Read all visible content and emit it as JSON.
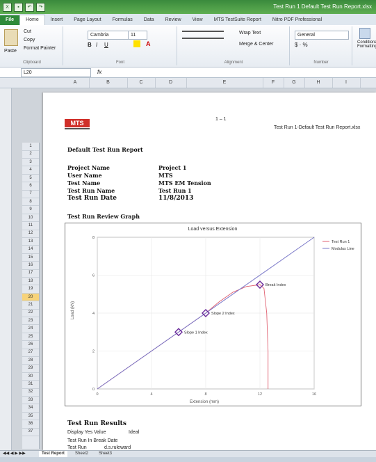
{
  "app": {
    "window_title": "Test Run 1 Default Test Run Report.xlsx"
  },
  "ribbon_tabs": [
    "File",
    "Home",
    "Insert",
    "Page Layout",
    "Formulas",
    "Data",
    "Review",
    "View",
    "MTS TestSuite Report",
    "Nitro PDF Professional"
  ],
  "ribbon": {
    "clipboard": {
      "paste": "Paste",
      "cut": "Cut",
      "copy": "Copy",
      "format_painter": "Format Painter",
      "group": "Clipboard"
    },
    "font": {
      "name": "Cambria",
      "size": "11",
      "group": "Font"
    },
    "alignment": {
      "wrap": "Wrap Text",
      "merge": "Merge & Center",
      "group": "Alignment"
    },
    "number": {
      "format": "General",
      "group": "Number"
    },
    "styles": {
      "conditional": "Conditional Formatting"
    }
  },
  "formula_bar": {
    "name_box": "L20",
    "fx": "fx"
  },
  "columns": [
    "A",
    "B",
    "C",
    "D",
    "E",
    "F",
    "G",
    "H",
    "I"
  ],
  "page": {
    "page_num": "1 – 1",
    "file_ref": "Test Run 1-Default Test Run Report.xlsx",
    "logo": "MTS",
    "report_title": "Default Test Run Report",
    "info": [
      {
        "label": "Project Name",
        "value": "Project 1"
      },
      {
        "label": "User Name",
        "value": "MTS"
      },
      {
        "label": "Test Name",
        "value": "MTS EM Tension"
      },
      {
        "label": "Test Run Name",
        "value": "Test Run 1"
      },
      {
        "label": "Test Run Date",
        "value": "11/8/2013"
      }
    ],
    "graph_heading": "Test Run Review Graph",
    "results_heading": "Test Run Results",
    "results_rows": [
      {
        "label": "Display Yes Value",
        "value": "Ideal"
      },
      {
        "label": "Test Run In Break Date",
        "value": ""
      },
      {
        "label": "Test Run",
        "value": "d.s.ruleward"
      }
    ]
  },
  "row_numbers": [
    "1",
    "2",
    "3",
    "4",
    "5",
    "6",
    "7",
    "8",
    "9",
    "10",
    "11",
    "12",
    "13",
    "14",
    "15",
    "16",
    "17",
    "18",
    "19",
    "20",
    "21",
    "22",
    "23",
    "24",
    "25",
    "26",
    "27",
    "28",
    "29",
    "30",
    "31",
    "32",
    "33",
    "34",
    "35",
    "36",
    "37"
  ],
  "selected_row": "20",
  "sheet_tabs": [
    "Test Report",
    "Sheet2",
    "Sheet3"
  ],
  "chart_data": {
    "type": "line",
    "title": "Load versus Extension",
    "xlabel": "Extension (mm)",
    "ylabel": "Load (kN)",
    "xlim": [
      0,
      16
    ],
    "ylim": [
      0,
      8
    ],
    "x_ticks": [
      "0",
      "4",
      "8",
      "12",
      "16"
    ],
    "y_ticks": [
      "0",
      "2",
      "4",
      "6",
      "8"
    ],
    "legend_position": "top-right",
    "series": [
      {
        "name": "Test Run 1",
        "color": "#e06070",
        "points": [
          [
            0,
            0
          ],
          [
            4,
            2
          ],
          [
            6,
            3
          ],
          [
            8,
            4
          ],
          [
            9,
            4.6
          ],
          [
            10,
            5.1
          ],
          [
            11,
            5.4
          ],
          [
            12,
            5.5
          ],
          [
            12.3,
            5.3
          ],
          [
            12.5,
            4
          ],
          [
            12.6,
            2
          ],
          [
            12.6,
            0
          ]
        ]
      },
      {
        "name": "Modulus Line",
        "color": "#7a78c8",
        "points": [
          [
            0,
            0
          ],
          [
            16,
            8
          ]
        ]
      }
    ],
    "markers": [
      {
        "label": "Slope 1 Index",
        "x": 6,
        "y": 3
      },
      {
        "label": "Slope 2 Index",
        "x": 8,
        "y": 4
      },
      {
        "label": "Break Index",
        "x": 12,
        "y": 5.5
      }
    ]
  }
}
